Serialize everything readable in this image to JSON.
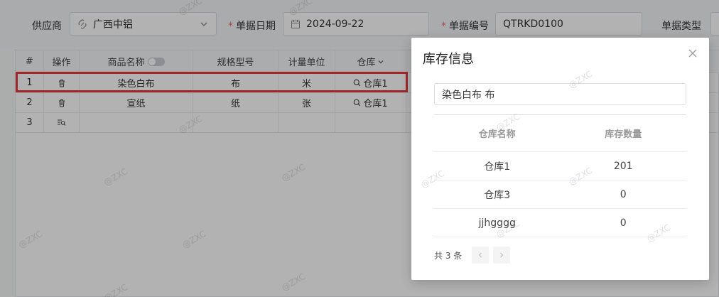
{
  "header": {
    "supplier_label": "供应商",
    "supplier_value": "广西中铝",
    "date_label": "单据日期",
    "date_value": "2024-09-22",
    "number_label": "单据编号",
    "number_value": "QTRKD0100",
    "type_label": "单据类型"
  },
  "table": {
    "columns": [
      "#",
      "操作",
      "商品名称",
      "规格型号",
      "计量单位",
      "仓库"
    ],
    "rows": [
      {
        "index": "1",
        "name": "染色白布",
        "spec": "布",
        "unit": "米",
        "warehouse": "仓库1"
      },
      {
        "index": "2",
        "name": "宣纸",
        "spec": "纸",
        "unit": "张",
        "warehouse": "仓库1"
      },
      {
        "index": "3",
        "name": "",
        "spec": "",
        "unit": "",
        "warehouse": ""
      }
    ]
  },
  "dialog": {
    "title": "库存信息",
    "search_value": "染色白布 布",
    "col_warehouse": "仓库名称",
    "col_qty": "库存数量",
    "rows": [
      {
        "warehouse": "仓库1",
        "qty": "201"
      },
      {
        "warehouse": "仓库3",
        "qty": "0"
      },
      {
        "warehouse": "jjhgggg",
        "qty": "0"
      }
    ],
    "total_text": "共 3 条"
  },
  "watermark": "@ZXC",
  "colors": {
    "highlight": "#e4393c",
    "required": "#f56c6c"
  }
}
